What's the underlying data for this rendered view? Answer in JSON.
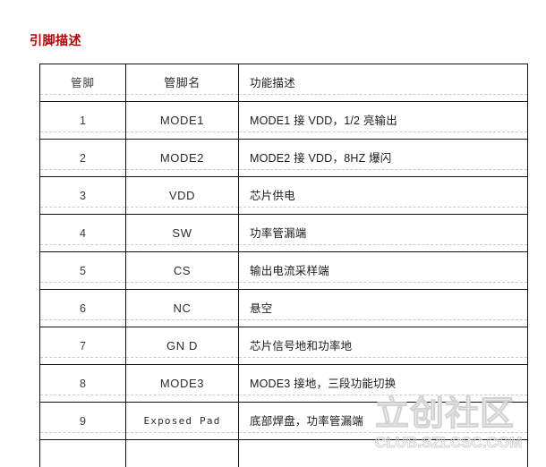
{
  "section": {
    "title": "引脚描述",
    "title_color": "#bb0000"
  },
  "table": {
    "columns": [
      {
        "key": "pin",
        "header": "管脚"
      },
      {
        "key": "name",
        "header": "管脚名"
      },
      {
        "key": "desc",
        "header": "功能描述"
      }
    ],
    "rows": [
      {
        "pin": "1",
        "name": "MODE1",
        "desc": "MODE1 接 VDD，1/2 亮输出"
      },
      {
        "pin": "2",
        "name": "MODE2",
        "desc": "MODE2 接 VDD，8HZ 爆闪"
      },
      {
        "pin": "3",
        "name": "VDD",
        "desc": "芯片供电"
      },
      {
        "pin": "4",
        "name": "SW",
        "desc": "功率管漏端"
      },
      {
        "pin": "5",
        "name": "CS",
        "desc": "输出电流采样端"
      },
      {
        "pin": "6",
        "name": "NC",
        "desc": "悬空"
      },
      {
        "pin": "7",
        "name": "GN D",
        "desc": "芯片信号地和功率地"
      },
      {
        "pin": "8",
        "name": "MODE3",
        "desc": "MODE3 接地，三段功能切换"
      },
      {
        "pin": "9",
        "name": "Exposed Pad",
        "desc": "底部焊盘，功率管漏端"
      }
    ]
  },
  "watermark": {
    "mark": "立创社区",
    "url": "CLUB.SZLCSC.COM"
  }
}
